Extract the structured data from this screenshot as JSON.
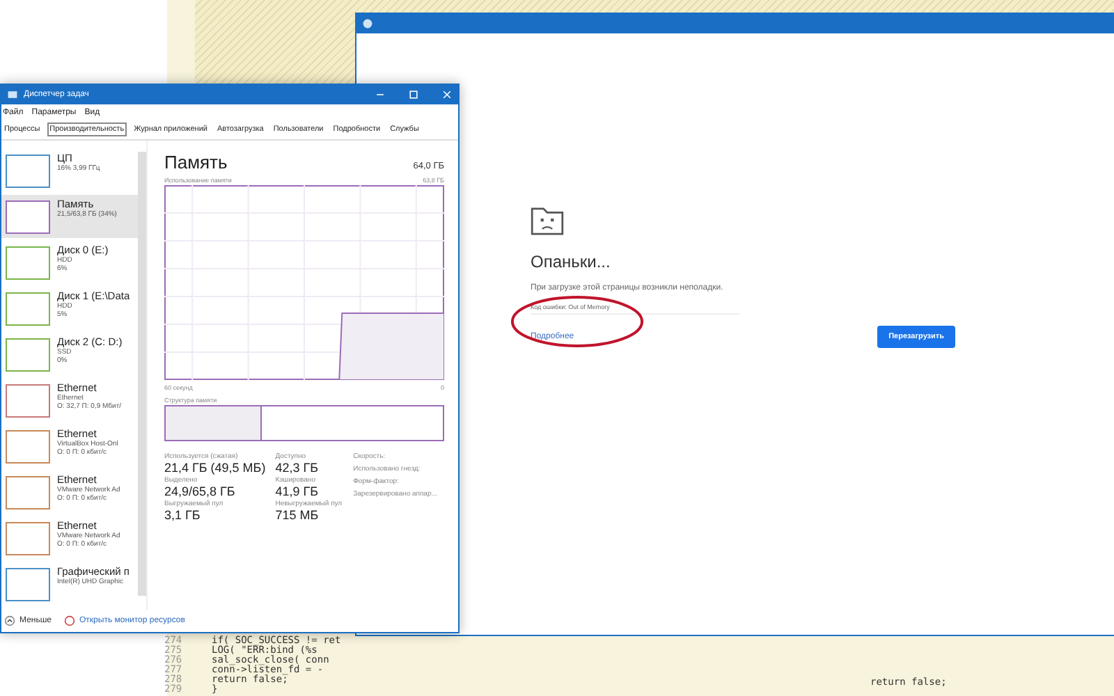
{
  "code_editor": {
    "lines": [
      {
        "number": "274",
        "code": "if( SOC_SUCCESS != ret"
      },
      {
        "number": "275",
        "code": "LOG( \"ERR:bind (%s"
      },
      {
        "number": "276",
        "code": "sal_sock_close( conn"
      },
      {
        "number": "277",
        "code": "conn->listen_fd = -"
      },
      {
        "number": "278",
        "code": "return false;"
      },
      {
        "number": "279",
        "code": "}"
      }
    ],
    "right_pane_code": "return false;"
  },
  "task_manager": {
    "title": "Диспетчер задач",
    "menu": [
      "Файл",
      "Параметры",
      "Вид"
    ],
    "tabs": [
      {
        "label": "Процессы",
        "selected": false
      },
      {
        "label": "Производительность",
        "selected": true
      },
      {
        "label": "Журнал приложений",
        "selected": false
      },
      {
        "label": "Автозагрузка",
        "selected": false
      },
      {
        "label": "Пользователи",
        "selected": false
      },
      {
        "label": "Подробности",
        "selected": false
      },
      {
        "label": "Службы",
        "selected": false
      }
    ],
    "sidebar": [
      {
        "name": "ЦП",
        "lines": [
          "16% 3,99 ГГц"
        ],
        "color": "#4a90c8",
        "selected": false
      },
      {
        "name": "Память",
        "lines": [
          "21,5/63,8 ГБ (34%)"
        ],
        "color": "#9b6cb8",
        "selected": true
      },
      {
        "name": "Диск 0 (E:)",
        "lines": [
          "HDD",
          "6%"
        ],
        "color": "#7ab648",
        "selected": false
      },
      {
        "name": "Диск 1 (E:\\Data",
        "lines": [
          "HDD",
          "5%"
        ],
        "color": "#7ab648",
        "selected": false
      },
      {
        "name": "Диск 2 (C: D:)",
        "lines": [
          "SSD",
          "0%"
        ],
        "color": "#7ab648",
        "selected": false
      },
      {
        "name": "Ethernet",
        "lines": [
          "Ethernet",
          "О: 32,7 П: 0,9 Мбит/"
        ],
        "color": "#c87878",
        "selected": false
      },
      {
        "name": "Ethernet",
        "lines": [
          "VirtualBox Host-Onl",
          "О: 0 П: 0 кбит/с"
        ],
        "color": "#c88a5a",
        "selected": false
      },
      {
        "name": "Ethernet",
        "lines": [
          "VMware Network Ad",
          "О: 0 П: 0 кбит/с"
        ],
        "color": "#c88a5a",
        "selected": false
      },
      {
        "name": "Ethernet",
        "lines": [
          "VMware Network Ad",
          "О: 0 П: 0 кбит/с"
        ],
        "color": "#c88a5a",
        "selected": false
      },
      {
        "name": "Графический п",
        "lines": [
          "Intel(R) UHD Graphic"
        ],
        "color": "#4a90c8",
        "selected": false
      }
    ],
    "panel": {
      "title": "Память",
      "total": "64,0 ГБ",
      "graph_label": "Использование памяти",
      "graph_max": "63,8 ГБ",
      "graph_time": "60 секунд",
      "graph_min": "0",
      "composition_label": "Структура памяти",
      "composition": {
        "level": 0.34
      },
      "stats": [
        {
          "label": "Используется (сжатая)",
          "value": "21,4 ГБ (49,5 МБ)"
        },
        {
          "label": "Доступно",
          "value": "42,3 ГБ"
        },
        {
          "label": "Выделено",
          "value": "24,9/65,8 ГБ"
        },
        {
          "label": "Кэшировано",
          "value": "41,9 ГБ"
        },
        {
          "label": "Выгружаемый пул",
          "value": "3,1 ГБ"
        },
        {
          "label": "Невыгружаемый пул",
          "value": "715 МБ"
        }
      ],
      "properties": [
        "Скорость:",
        "Использовано гнезд:",
        "Форм-фактор:",
        "Зарезервировано аппар..."
      ]
    },
    "footer": {
      "less": "Меньше",
      "monitor_link": "Открыть монитор ресурсов"
    }
  },
  "browser": {
    "heading": "Опаньки...",
    "message": "При загрузке этой страницы возникли неполадки.",
    "error_code": "Код ошибки: Out of Memory",
    "details_link": "Подробнее",
    "reload_button": "Перезагрузить"
  }
}
